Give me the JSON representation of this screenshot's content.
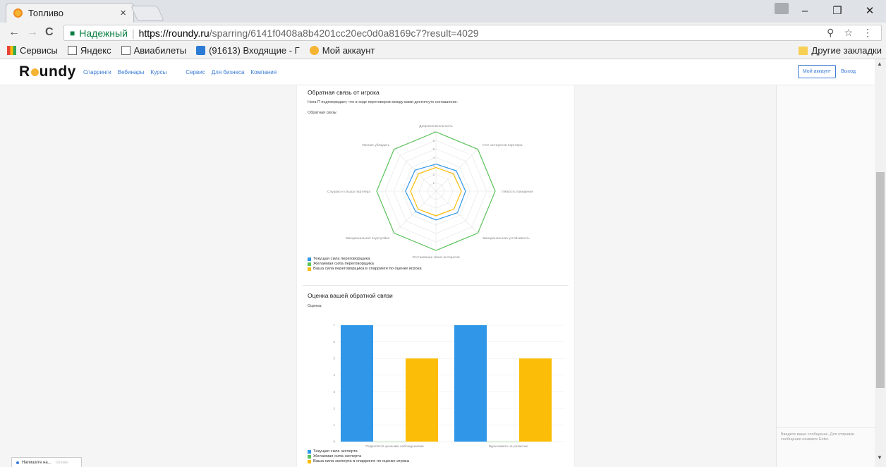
{
  "browser": {
    "tab_title": "Топливо",
    "tab_close": "×",
    "win_minimize": "–",
    "win_restore": "❐",
    "win_close": "✕",
    "nav_back": "←",
    "nav_forward": "→",
    "nav_reload": "C",
    "secure_label": "Надежный",
    "url_host": "https://roundy.ru",
    "url_path": "/sparring/6141f0408a8b4201cc20ec0d0a8169c7?result=4029",
    "zoom_icon": "⚲",
    "star_icon": "☆",
    "menu_icon": "⋮",
    "bookmarks": [
      "Сервисы",
      "Яндекс",
      "Авиабилеты",
      "(91613) Входящие - Г",
      "Мой аккаунт"
    ],
    "other_bookmarks": "Другие закладки"
  },
  "site": {
    "logo_left": "R",
    "logo_right": "undy",
    "menu": [
      "Спарринги",
      "Вебинары",
      "Курсы",
      "Сервис",
      "Для бизнеса",
      "Компания"
    ],
    "account_button": "Мой аккаунт",
    "logout": "Выход"
  },
  "feedback": {
    "title": "Обратная связь от игрока",
    "text": "Ната П подтверждает, что в ходе переговоров между вами достигнуто соглашение.",
    "label": "Обратная связь:"
  },
  "rating": {
    "title": "Оценка вашей обратной связи",
    "label": "Оценка:"
  },
  "chat": {
    "placeholder": "Введите ваше сообщение. Для отправки сообщения нажмите Enter."
  },
  "widget": {
    "label": "Напишите на...",
    "sub": "Онлайн"
  },
  "colors": {
    "blue": "#2f96e8",
    "green": "#5cc15c",
    "yellow": "#fbbd08"
  },
  "chart_data": [
    {
      "type": "radar",
      "axes": [
        "Доброжелательность",
        "Учет интересов партнёра",
        "Гибкость поведения",
        "Эмоциональная устойчивость",
        "Отстаивание своих интересов",
        "Эмоциональная подстройка",
        "Слушаю и слышу партнёра",
        "Умение убеждать"
      ],
      "rmax": 7,
      "ticks": [
        "1",
        "2",
        "3",
        "4",
        "5",
        "6",
        "7"
      ],
      "series": [
        {
          "name": "Текущая сила переговорщика",
          "color": "#2f96e8",
          "values": [
            3.2,
            3.4,
            3.5,
            3.6,
            3.4,
            3.4,
            3.6,
            3.5
          ]
        },
        {
          "name": "Желаемая сила переговорщика",
          "color": "#5cc15c",
          "values": [
            7,
            7,
            7,
            7,
            7,
            7,
            7,
            7
          ]
        },
        {
          "name": "Ваша сила переговорщика в спарринге по оценке игрока",
          "color": "#fbbd08",
          "values": [
            2.8,
            2.9,
            3.0,
            3.0,
            2.9,
            3.0,
            3.0,
            2.9
          ]
        }
      ]
    },
    {
      "type": "bar",
      "categories": [
        "Подкопятся ценными наблюдениями",
        "Вдохновило на развитие"
      ],
      "ylim": [
        0,
        7
      ],
      "yticks": [
        "0",
        "1",
        "2",
        "3",
        "4",
        "5",
        "6",
        "7"
      ],
      "series": [
        {
          "name": "Текущая сила эксперта",
          "color": "#2f96e8",
          "values": [
            7,
            7
          ]
        },
        {
          "name": "Желаемая сила эксперта",
          "color": "#5cc15c",
          "values": [
            0,
            0
          ]
        },
        {
          "name": "Ваша сила эксперта в спарринге по оценке игрока",
          "color": "#fbbd08",
          "values": [
            5,
            5
          ]
        }
      ]
    }
  ]
}
